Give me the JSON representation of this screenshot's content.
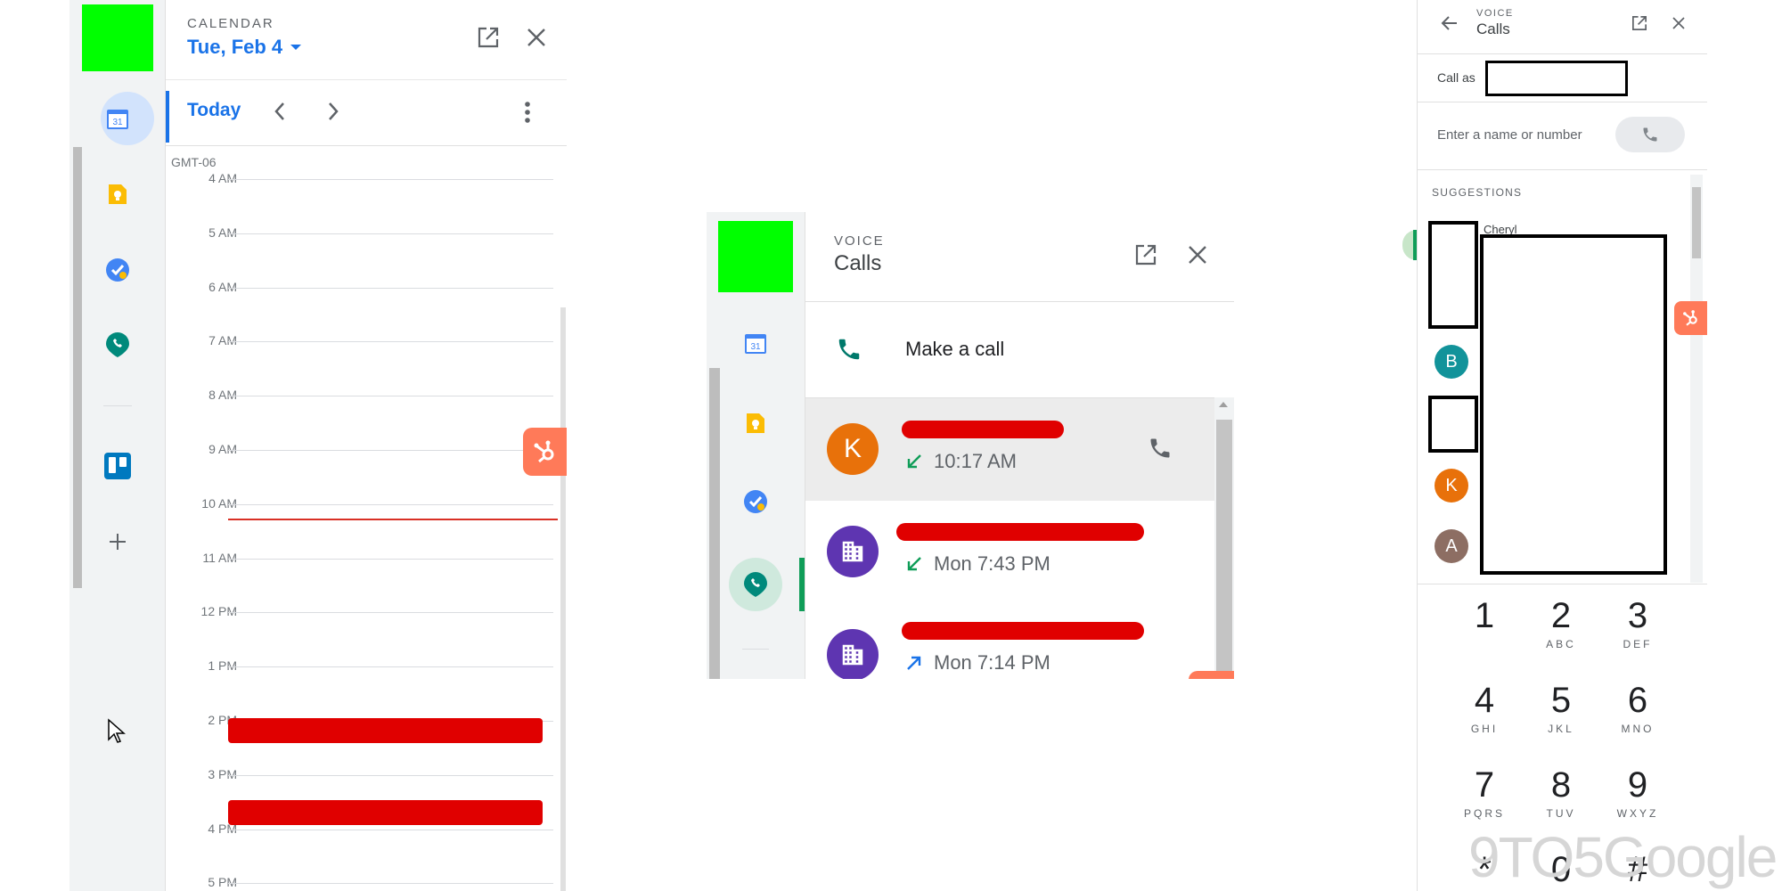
{
  "calendar": {
    "eyebrow": "CALENDAR",
    "date_label": "Tue, Feb 4",
    "today_label": "Today",
    "timezone": "GMT-06",
    "hours": [
      "4 AM",
      "5 AM",
      "6 AM",
      "7 AM",
      "8 AM",
      "9 AM",
      "10 AM",
      "11 AM",
      "12 PM",
      "1 PM",
      "2 PM",
      "3 PM",
      "4 PM",
      "5 PM"
    ],
    "accent": "#1a73e8"
  },
  "voice_small": {
    "eyebrow": "VOICE",
    "title": "Calls",
    "make_call_label": "Make a call",
    "calls": [
      {
        "avatar": "K",
        "avatar_color": "#e8710a",
        "direction": "incoming",
        "time": "10:17 AM"
      },
      {
        "avatar": "building",
        "avatar_color": "#5e35b1",
        "direction": "incoming",
        "time": "Mon 7:43 PM"
      },
      {
        "avatar": "building",
        "avatar_color": "#5e35b1",
        "direction": "outgoing",
        "time": "Mon 7:14 PM"
      }
    ]
  },
  "voice_dialer": {
    "eyebrow": "VOICE",
    "title": "Calls",
    "call_as_label": "Call as",
    "input_placeholder": "Enter a name or number",
    "suggestions_label": "SUGGESTIONS",
    "first_suggestion_name": "Cheryl",
    "suggestion_avatars": [
      {
        "letter": "B",
        "color": "#12939a"
      },
      {
        "letter": "K",
        "color": "#e8710a"
      },
      {
        "letter": "A",
        "color": "#8d6e63"
      }
    ],
    "keypad": [
      {
        "num": "1",
        "letters": ""
      },
      {
        "num": "2",
        "letters": "ABC"
      },
      {
        "num": "3",
        "letters": "DEF"
      },
      {
        "num": "4",
        "letters": "GHI"
      },
      {
        "num": "5",
        "letters": "JKL"
      },
      {
        "num": "6",
        "letters": "MNO"
      },
      {
        "num": "7",
        "letters": "PQRS"
      },
      {
        "num": "8",
        "letters": "TUV"
      },
      {
        "num": "9",
        "letters": "WXYZ"
      },
      {
        "num": "*",
        "letters": ""
      },
      {
        "num": "0",
        "letters": ""
      },
      {
        "num": "#",
        "letters": ""
      }
    ]
  },
  "watermark": "9TO5Google",
  "colors": {
    "redaction": "#e00000",
    "hubspot": "#ff7a59",
    "placeholder_block": "#00ff00",
    "voice_green": "#0f9d58"
  }
}
